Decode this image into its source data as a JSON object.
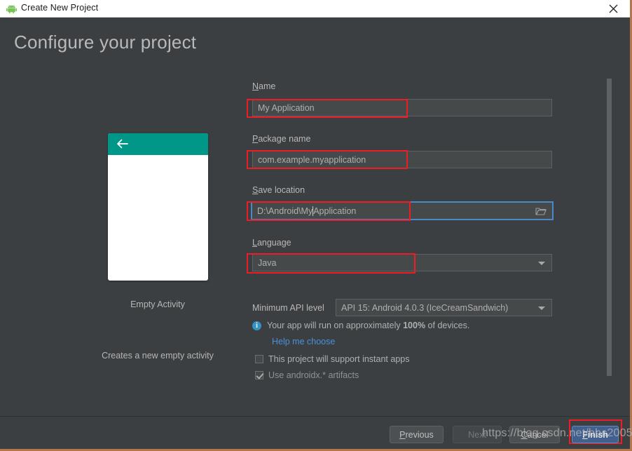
{
  "window": {
    "title": "Create New Project",
    "app_icon": "android-icon",
    "close_icon": "close-icon"
  },
  "header": {
    "title": "Configure your project"
  },
  "preview": {
    "back_icon": "arrow-left-icon",
    "template_name": "Empty Activity",
    "template_description": "Creates a new empty activity",
    "accent_color": "#009688"
  },
  "form": {
    "name": {
      "label": "Name",
      "mnemonic": "N",
      "label_rest": "ame",
      "value": "My Application"
    },
    "package": {
      "label": "Package name",
      "mnemonic": "P",
      "label_rest": "ackage name",
      "value": "com.example.myapplication"
    },
    "save_location": {
      "label": "Save location",
      "mnemonic": "S",
      "label_rest": "ave location",
      "value_before_caret": "D:\\Android\\My",
      "value_after_caret": "Application",
      "browse_icon": "folder-icon",
      "focused": true
    },
    "language": {
      "label": "Language",
      "mnemonic": "L",
      "label_rest": "anguage",
      "value": "Java",
      "dropdown_icon": "chevron-down-icon"
    },
    "min_api": {
      "label": "Minimum API level",
      "value": "API 15: Android 4.0.3 (IceCreamSandwich)",
      "dropdown_icon": "chevron-down-icon"
    },
    "device_info": {
      "icon": "info-icon",
      "text_before": "Your app will run on approximately ",
      "percent": "100%",
      "text_after": " of devices.",
      "link": "Help me choose",
      "link_color": "#4a90d9"
    },
    "checkboxes": [
      {
        "label": "This project will support instant apps",
        "checked": false
      },
      {
        "label": "Use androidx.* artifacts",
        "checked": true
      }
    ]
  },
  "footer": {
    "previous": {
      "mnemonic": "P",
      "rest": "revious"
    },
    "next": {
      "label": "Next"
    },
    "cancel": {
      "mnemonic": "C",
      "rest": "ancel"
    },
    "finish": {
      "mnemonic": "F",
      "rest": "inish"
    }
  },
  "watermark": {
    "text": "https://blog.csdn.net/bbc2005"
  },
  "annotation_color": "#ee1c25"
}
